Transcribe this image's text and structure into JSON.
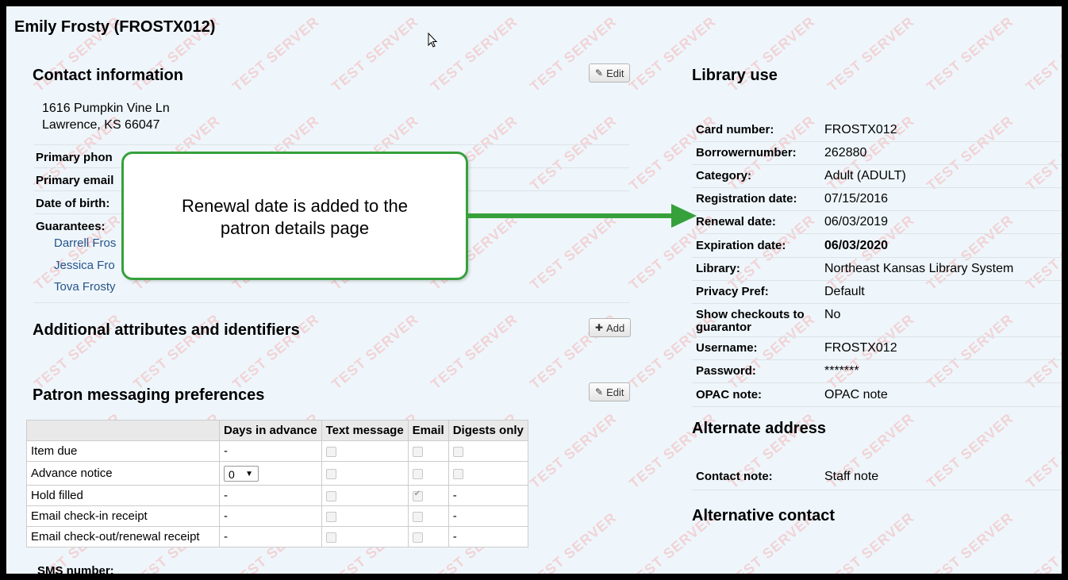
{
  "page_title": "Emily Frosty (FROSTX012)",
  "contact": {
    "heading": "Contact information",
    "edit_label": "Edit",
    "address_line1": "1616 Pumpkin Vine Ln",
    "address_line2": "Lawrence, KS 66047",
    "primary_phone_label": "Primary phon",
    "primary_email_label": "Primary email",
    "dob_label": "Date of birth:",
    "guarantees_label": "Guarantees:",
    "guarantees": [
      "Darrell Fros",
      "Jessica Fro",
      "Tova Frosty"
    ]
  },
  "attributes": {
    "heading": "Additional attributes and identifiers",
    "add_label": "Add"
  },
  "messaging": {
    "heading": "Patron messaging preferences",
    "edit_label": "Edit",
    "columns": [
      "",
      "Days in advance",
      "Text message",
      "Email",
      "Digests only"
    ],
    "rows": [
      {
        "name": "Item due",
        "days": "-",
        "email_checked": false,
        "digest": "checkbox"
      },
      {
        "name": "Advance notice",
        "days": "0",
        "email_checked": false,
        "digest": "checkbox"
      },
      {
        "name": "Hold filled",
        "days": "-",
        "email_checked": true,
        "digest": "-"
      },
      {
        "name": "Email check-in receipt",
        "days": "-",
        "email_checked": false,
        "digest": "-"
      },
      {
        "name": "Email check-out/renewal receipt",
        "days": "-",
        "email_checked": false,
        "digest": "-"
      }
    ],
    "sms_label": "SMS number:"
  },
  "library_use": {
    "heading": "Library use",
    "fields": [
      {
        "label": "Card number:",
        "value": "FROSTX012"
      },
      {
        "label": "Borrowernumber:",
        "value": "262880"
      },
      {
        "label": "Category:",
        "value": "Adult (ADULT)"
      },
      {
        "label": "Registration date:",
        "value": "07/15/2016"
      },
      {
        "label": "Renewal date:",
        "value": "06/03/2019"
      },
      {
        "label": "Expiration date:",
        "value": "06/03/2020"
      },
      {
        "label": "Library:",
        "value": "Northeast Kansas Library System"
      },
      {
        "label": "Privacy Pref:",
        "value": "Default"
      },
      {
        "label": "Show checkouts to guarantor",
        "value": "No"
      },
      {
        "label": "Username:",
        "value": "FROSTX012"
      },
      {
        "label": "Password:",
        "value": "*******"
      },
      {
        "label": "OPAC note:",
        "value": "OPAC note"
      }
    ]
  },
  "alternate_address": {
    "heading": "Alternate address",
    "contact_note_label": "Contact note:",
    "contact_note_value": "Staff note"
  },
  "alternative_contact": {
    "heading": "Alternative contact"
  },
  "callout": {
    "text": "Renewal date is added to the patron details page",
    "color": "#36a13b"
  },
  "watermark": "TEST SERVER"
}
